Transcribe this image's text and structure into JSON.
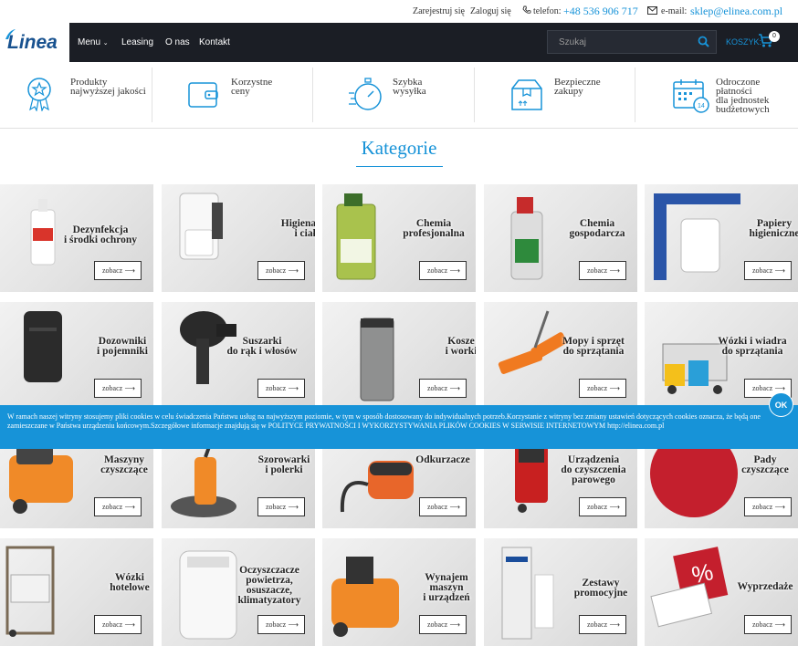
{
  "topbar": {
    "register": "Zarejestruj się",
    "login": "Zaloguj się",
    "phone_label": "telefon:",
    "phone": "+48 536 906 717",
    "email_label": "e-mail:",
    "email": "sklep@elinea.com.pl"
  },
  "logo": "Linea",
  "nav": {
    "menu": "Menu",
    "leasing": "Leasing",
    "about": "O nas",
    "contact": "Kontakt",
    "search_placeholder": "Szukaj",
    "cart_label": "KOSZYK:",
    "cart_count": "0"
  },
  "benefits": [
    {
      "line1": "Produkty",
      "line2": "najwyższej jakości",
      "line3": "",
      "line4": "",
      "icon": "award-icon"
    },
    {
      "line1": "Korzystne",
      "line2": "ceny",
      "line3": "",
      "line4": "",
      "icon": "wallet-icon"
    },
    {
      "line1": "Szybka",
      "line2": "wysyłka",
      "line3": "",
      "line4": "",
      "icon": "stopwatch-icon"
    },
    {
      "line1": "Bezpieczne",
      "line2": "zakupy",
      "line3": "",
      "line4": "",
      "icon": "package-icon"
    },
    {
      "line1": "Odroczone",
      "line2": "płatności",
      "line3": "dla jednostek",
      "line4": "budżetowych",
      "icon": "calendar-icon"
    }
  ],
  "categories_title": "Kategorie",
  "button_label": "zobacz",
  "categories": [
    {
      "l1": "Dezynfekcja",
      "l2": "i środki ochrony",
      "l3": ""
    },
    {
      "l1": "Higiena rąk",
      "l2": "i ciała",
      "l3": ""
    },
    {
      "l1": "Chemia",
      "l2": "profesjonalna",
      "l3": ""
    },
    {
      "l1": "Chemia",
      "l2": "gospodarcza",
      "l3": ""
    },
    {
      "l1": "Papiery",
      "l2": "higieniczne",
      "l3": ""
    },
    {
      "l1": "Dozowniki",
      "l2": "i pojemniki",
      "l3": ""
    },
    {
      "l1": "Suszarki",
      "l2": "do rąk i włosów",
      "l3": ""
    },
    {
      "l1": "Kosze",
      "l2": "i worki",
      "l3": ""
    },
    {
      "l1": "Mopy i sprzęt",
      "l2": "do sprzątania",
      "l3": ""
    },
    {
      "l1": "Wózki i wiadra",
      "l2": "do sprzątania",
      "l3": ""
    },
    {
      "l1": "Maszyny",
      "l2": "czyszczące",
      "l3": ""
    },
    {
      "l1": "Szorowarki",
      "l2": "i polerki",
      "l3": ""
    },
    {
      "l1": "Odkurzacze",
      "l2": "",
      "l3": ""
    },
    {
      "l1": "Urządzenia",
      "l2": "do czyszczenia",
      "l3": "parowego"
    },
    {
      "l1": "Pady",
      "l2": "czyszczące",
      "l3": ""
    },
    {
      "l1": "Wózki",
      "l2": "hotelowe",
      "l3": ""
    },
    {
      "l1": "Oczyszczacze",
      "l2": "powietrza,",
      "l3": "osuszacze,",
      "l4": "klimatyzatory"
    },
    {
      "l1": "Wynajem",
      "l2": "maszyn",
      "l3": "i urządzeń"
    },
    {
      "l1": "Zestawy",
      "l2": "promocyjne",
      "l3": ""
    },
    {
      "l1": "Wyprzedaże",
      "l2": "",
      "l3": ""
    }
  ],
  "cookie": {
    "text": "W ramach naszej witryny stosujemy pliki cookies w celu świadczenia Państwu usług na najwyższym poziomie, w tym w sposób dostosowany do indywidualnych potrzeb.Korzystanie z witryny bez zmiany ustawień dotyczących cookies oznacza, że będą one zamieszczane w Państwa urządzeniu końcowym.Szczegółowe informacje znajdują się w POLITYCE PRYWATNOŚCI I WYKORZYSTYWANIA PLIKÓW COOKIES W SERWISIE INTERNETOWYM http://elinea.com.pl",
    "ok": "OK"
  },
  "colors": {
    "accent": "#1793d8",
    "navbar": "#1b1e25",
    "logo": "#17518f"
  }
}
